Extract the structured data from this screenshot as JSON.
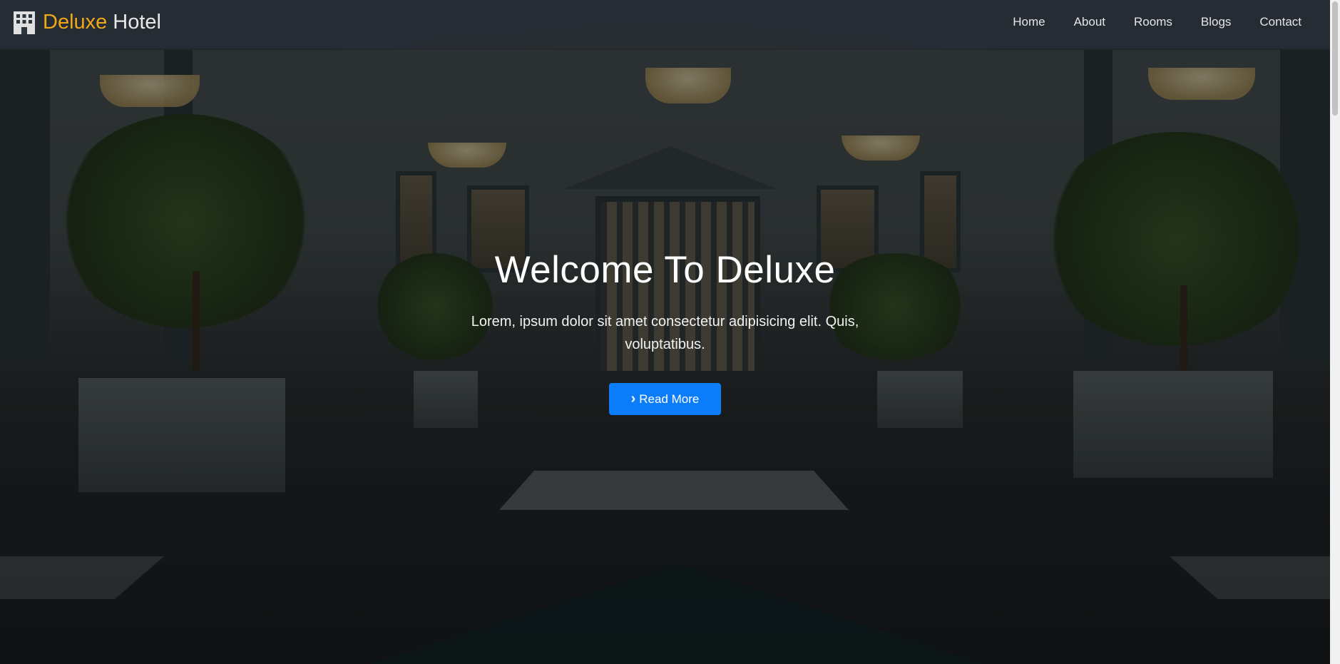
{
  "brand": {
    "accent_word": "Deluxe",
    "rest_word": "Hotel",
    "icon": "hotel-building-icon",
    "accent_color": "#f0a818"
  },
  "nav": {
    "items": [
      "Home",
      "About",
      "Rooms",
      "Blogs",
      "Contact"
    ]
  },
  "hero": {
    "title": "Welcome To Deluxe",
    "text": "Lorem, ipsum dolor sit amet consectetur adipisicing elit. Quis, voluptatibus.",
    "button_label": "Read More",
    "button_icon": "chevron-right-icon",
    "button_color": "#0b7dfa"
  }
}
